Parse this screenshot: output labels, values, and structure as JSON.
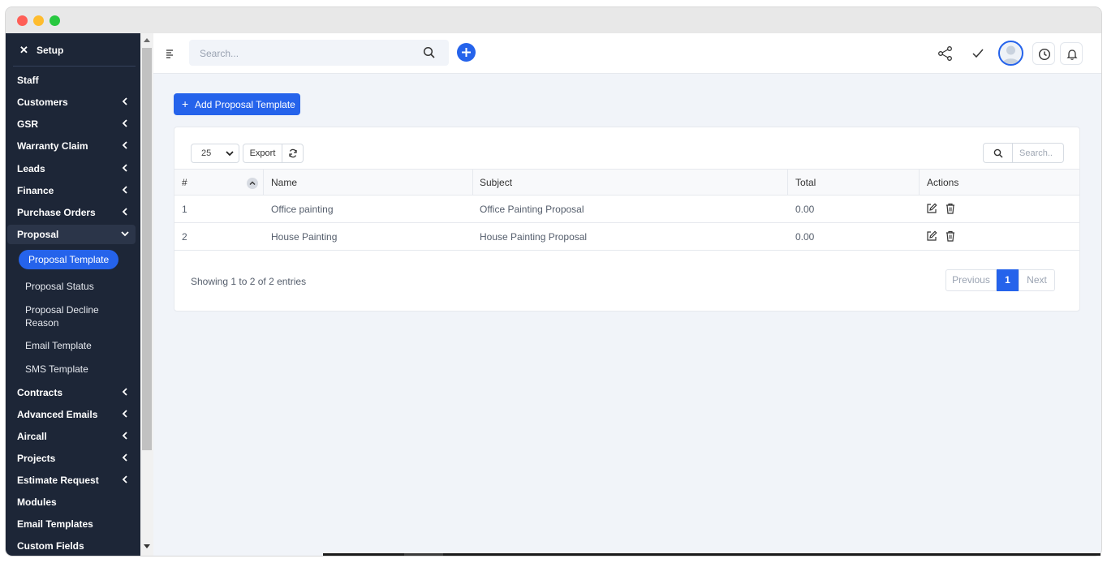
{
  "sidebar": {
    "header": {
      "close": "✕",
      "title": "Setup"
    },
    "items": [
      {
        "label": "Staff"
      },
      {
        "label": "Customers"
      },
      {
        "label": "GSR"
      },
      {
        "label": "Warranty Claim"
      },
      {
        "label": "Leads"
      },
      {
        "label": "Finance"
      },
      {
        "label": "Purchase Orders"
      },
      {
        "label": "Proposal"
      },
      {
        "label": "Contracts"
      },
      {
        "label": "Advanced Emails"
      },
      {
        "label": "Aircall"
      },
      {
        "label": "Projects"
      },
      {
        "label": "Estimate Request"
      },
      {
        "label": "Modules"
      },
      {
        "label": "Email Templates"
      },
      {
        "label": "Custom Fields"
      }
    ],
    "proposal_sub": [
      {
        "label": "Proposal Template"
      },
      {
        "label": "Proposal Status"
      },
      {
        "label": "Proposal Decline Reason"
      },
      {
        "label": "Email Template"
      },
      {
        "label": "SMS Template"
      }
    ]
  },
  "topbar": {
    "search_placeholder": "Search...",
    "icons": [
      "menu-icon",
      "search-icon",
      "plus-icon",
      "share-icon",
      "check-icon",
      "avatar",
      "clock-icon",
      "bell-icon"
    ]
  },
  "page": {
    "add_button": "Add Proposal Template",
    "add_button_icon": "+"
  },
  "table": {
    "page_size": "25",
    "export_label": "Export",
    "search_placeholder": "Search..",
    "columns": [
      "#",
      "Name",
      "Subject",
      "Total",
      "Actions"
    ],
    "rows": [
      {
        "num": "1",
        "name": "Office painting",
        "subject": "Office Painting Proposal",
        "total": "0.00"
      },
      {
        "num": "2",
        "name": "House Painting",
        "subject": "House Painting Proposal",
        "total": "0.00"
      }
    ],
    "info": "Showing 1 to 2 of 2 entries",
    "pagination": {
      "previous": "Previous",
      "current": "1",
      "next": "Next"
    }
  },
  "colors": {
    "accent": "#2563eb",
    "sidebar_bg": "#1d2637",
    "content_bg": "#f1f4f9"
  }
}
